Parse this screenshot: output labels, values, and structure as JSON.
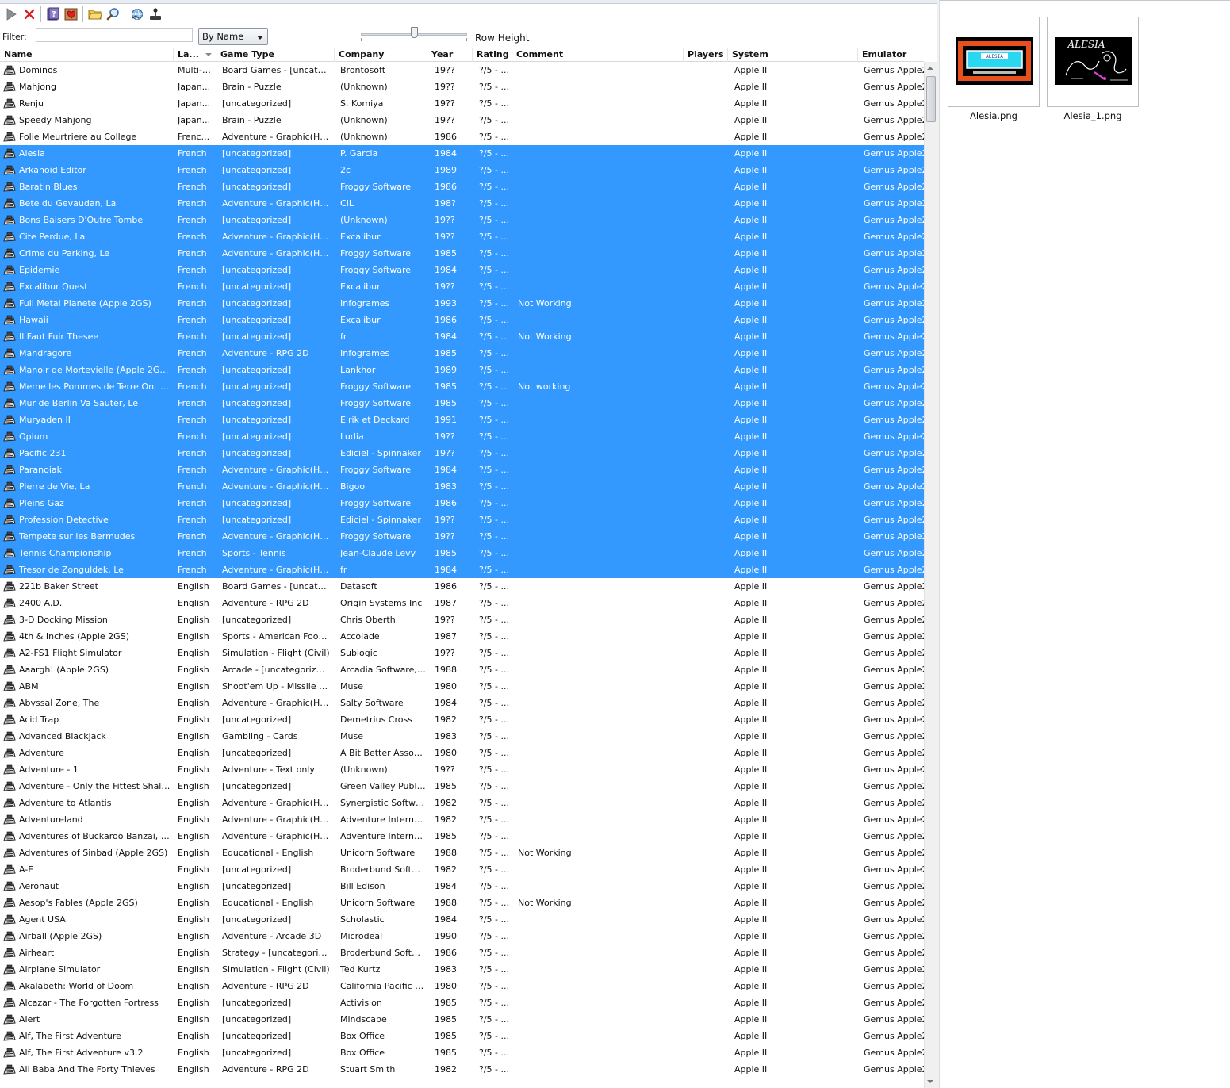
{
  "toolbar": {
    "buttons": [
      {
        "name": "play-button",
        "icon": "play-icon"
      },
      {
        "name": "remove-button",
        "icon": "close-icon"
      },
      {
        "name": "help-button",
        "icon": "help-icon"
      },
      {
        "name": "favorite-button",
        "icon": "heart-icon"
      },
      {
        "name": "open-folder-button",
        "icon": "folder-icon"
      },
      {
        "name": "search-button",
        "icon": "magnifier-icon"
      },
      {
        "name": "network-button",
        "icon": "globe-icon"
      },
      {
        "name": "download-button",
        "icon": "joystick-icon"
      }
    ]
  },
  "filter": {
    "label": "Filter:",
    "value": "",
    "sort_selected": "By Name",
    "row_height_label": "Row Height",
    "row_height_level": 0.5
  },
  "columns": [
    {
      "key": "name",
      "label": "Name"
    },
    {
      "key": "lang",
      "label": "La..."
    },
    {
      "key": "type",
      "label": "Game Type"
    },
    {
      "key": "company",
      "label": "Company"
    },
    {
      "key": "year",
      "label": "Year"
    },
    {
      "key": "rating",
      "label": "Rating"
    },
    {
      "key": "comment",
      "label": "Comment"
    },
    {
      "key": "players",
      "label": "Players"
    },
    {
      "key": "system",
      "label": "System"
    },
    {
      "key": "emulator",
      "label": "Emulator"
    }
  ],
  "rows": [
    [
      "Dominos",
      "Multi-L...",
      "Board Games - [uncatego...",
      "Brontosoft",
      "19??",
      "?/5 - ...",
      "",
      "",
      "Apple II",
      "Gemus Apple2M",
      0
    ],
    [
      "Mahjong",
      "Japan...",
      "Brain - Puzzle",
      "(Unknown)",
      "19??",
      "?/5 - ...",
      "",
      "",
      "Apple II",
      "Gemus Apple2M",
      0
    ],
    [
      "Renju",
      "Japan...",
      "[uncategorized]",
      "S. Komiya",
      "19??",
      "?/5 - ...",
      "",
      "",
      "Apple II",
      "Gemus Apple2M",
      0
    ],
    [
      "Speedy Mahjong",
      "Japan...",
      "Brain - Puzzle",
      "(Unknown)",
      "19??",
      "?/5 - ...",
      "",
      "",
      "Apple II",
      "Gemus Apple2M",
      0
    ],
    [
      "Folie Meurtriere au College",
      "Frenc...",
      "Adventure - Graphic(Hi-R...",
      "(Unknown)",
      "1986",
      "?/5 - ...",
      "",
      "",
      "Apple II",
      "Gemus Apple2M",
      0
    ],
    [
      "Alesia",
      "French",
      "[uncategorized]",
      "P. Garcia",
      "1984",
      "?/5 - ...",
      "",
      "",
      "Apple II",
      "Gemus Apple2M",
      1
    ],
    [
      "Arkanoid Editor",
      "French",
      "[uncategorized]",
      "2c",
      "1989",
      "?/5 - ...",
      "",
      "",
      "Apple II",
      "Gemus Apple2M",
      1
    ],
    [
      "Baratin Blues",
      "French",
      "[uncategorized]",
      "Froggy Software",
      "1986",
      "?/5 - ...",
      "",
      "",
      "Apple II",
      "Gemus Apple2M",
      1
    ],
    [
      "Bete du Gevaudan, La",
      "French",
      "Adventure - Graphic(Hi-R...",
      "CIL",
      "198?",
      "?/5 - ...",
      "",
      "",
      "Apple II",
      "Gemus Apple2M",
      1
    ],
    [
      "Bons Baisers D'Outre Tombe",
      "French",
      "[uncategorized]",
      "(Unknown)",
      "19??",
      "?/5 - ...",
      "",
      "",
      "Apple II",
      "Gemus Apple2M",
      1
    ],
    [
      "Cite Perdue, La",
      "French",
      "Adventure - Graphic(Hi-R...",
      "Excalibur",
      "19??",
      "?/5 - ...",
      "",
      "",
      "Apple II",
      "Gemus Apple2M",
      1
    ],
    [
      "Crime du Parking, Le",
      "French",
      "Adventure - Graphic(Hi-R...",
      "Froggy Software",
      "1985",
      "?/5 - ...",
      "",
      "",
      "Apple II",
      "Gemus Apple2M",
      1
    ],
    [
      "Epidemie",
      "French",
      "[uncategorized]",
      "Froggy Software",
      "1984",
      "?/5 - ...",
      "",
      "",
      "Apple II",
      "Gemus Apple2M",
      1
    ],
    [
      "Excalibur Quest",
      "French",
      "[uncategorized]",
      "Excalibur",
      "19??",
      "?/5 - ...",
      "",
      "",
      "Apple II",
      "Gemus Apple2M",
      1
    ],
    [
      "Full Metal Planete (Apple 2GS)",
      "French",
      "[uncategorized]",
      "Infogrames",
      "1993",
      "?/5 - ...",
      "Not Working",
      "",
      "Apple II",
      "Gemus Apple2M",
      1
    ],
    [
      "Hawaii",
      "French",
      "[uncategorized]",
      "Excalibur",
      "1986",
      "?/5 - ...",
      "",
      "",
      "Apple II",
      "Gemus Apple2M",
      1
    ],
    [
      "Il Faut Fuir Thesee",
      "French",
      "[uncategorized]",
      "fr",
      "1984",
      "?/5 - ...",
      "Not Working",
      "",
      "Apple II",
      "Gemus Apple2M",
      1
    ],
    [
      "Mandragore",
      "French",
      "Adventure - RPG 2D",
      "Infogrames",
      "1985",
      "?/5 - ...",
      "",
      "",
      "Apple II",
      "Gemus Apple2M",
      1
    ],
    [
      "Manoir de Mortevielle (Apple 2GS), Le",
      "French",
      "[uncategorized]",
      "Lankhor",
      "1989",
      "?/5 - ...",
      "",
      "",
      "Apple II",
      "Gemus Apple2M",
      1
    ],
    [
      "Meme les Pommes de Terre Ont des ...",
      "French",
      "[uncategorized]",
      "Froggy Software",
      "1985",
      "?/5 - ...",
      "Not working",
      "",
      "Apple II",
      "Gemus Apple2M",
      1
    ],
    [
      "Mur de Berlin Va Sauter, Le",
      "French",
      "[uncategorized]",
      "Froggy Software",
      "1985",
      "?/5 - ...",
      "",
      "",
      "Apple II",
      "Gemus Apple2M",
      1
    ],
    [
      "Muryaden II",
      "French",
      "[uncategorized]",
      "Elrik et Deckard",
      "1991",
      "?/5 - ...",
      "",
      "",
      "Apple II",
      "Gemus Apple2M",
      1
    ],
    [
      "Opium",
      "French",
      "[uncategorized]",
      "Ludia",
      "19??",
      "?/5 - ...",
      "",
      "",
      "Apple II",
      "Gemus Apple2M",
      1
    ],
    [
      "Pacific 231",
      "French",
      "[uncategorized]",
      "Ediciel - Spinnaker",
      "19??",
      "?/5 - ...",
      "",
      "",
      "Apple II",
      "Gemus Apple2M",
      1
    ],
    [
      "Paranoiak",
      "French",
      "Adventure - Graphic(Hi-R...",
      "Froggy Software",
      "1984",
      "?/5 - ...",
      "",
      "",
      "Apple II",
      "Gemus Apple2M",
      1
    ],
    [
      "Pierre de Vie, La",
      "French",
      "Adventure - Graphic(Hi-R...",
      "Bigoo",
      "1983",
      "?/5 - ...",
      "",
      "",
      "Apple II",
      "Gemus Apple2M",
      1
    ],
    [
      "Pleins Gaz",
      "French",
      "[uncategorized]",
      "Froggy Software",
      "1986",
      "?/5 - ...",
      "",
      "",
      "Apple II",
      "Gemus Apple2M",
      1
    ],
    [
      "Profession Detective",
      "French",
      "[uncategorized]",
      "Ediciel - Spinnaker",
      "19??",
      "?/5 - ...",
      "",
      "",
      "Apple II",
      "Gemus Apple2M",
      1
    ],
    [
      "Tempete sur les Bermudes",
      "French",
      "Adventure - Graphic(Hi-R...",
      "Froggy Software",
      "19??",
      "?/5 - ...",
      "",
      "",
      "Apple II",
      "Gemus Apple2M",
      1
    ],
    [
      "Tennis Championship",
      "French",
      "Sports - Tennis",
      "Jean-Claude Levy",
      "1985",
      "?/5 - ...",
      "",
      "",
      "Apple II",
      "Gemus Apple2M",
      1
    ],
    [
      "Tresor de Zonguldek, Le",
      "French",
      "Adventure - Graphic(Hi-R...",
      "fr",
      "1984",
      "?/5 - ...",
      "",
      "",
      "Apple II",
      "Gemus Apple2M",
      1
    ],
    [
      "221b Baker Street",
      "English",
      "Board Games - [uncatego...",
      "Datasoft",
      "1986",
      "?/5 - ...",
      "",
      "",
      "Apple II",
      "Gemus Apple2M",
      0
    ],
    [
      "2400 A.D.",
      "English",
      "Adventure - RPG 2D",
      "Origin Systems Inc",
      "1987",
      "?/5 - ...",
      "",
      "",
      "Apple II",
      "Gemus Apple2M",
      0
    ],
    [
      "3-D Docking Mission",
      "English",
      "[uncategorized]",
      "Chris Oberth",
      "19??",
      "?/5 - ...",
      "",
      "",
      "Apple II",
      "Gemus Apple2M",
      0
    ],
    [
      "4th & Inches (Apple 2GS)",
      "English",
      "Sports - American Football",
      "Accolade",
      "1987",
      "?/5 - ...",
      "",
      "",
      "Apple II",
      "Gemus Apple2M",
      0
    ],
    [
      "A2-FS1 Flight Simulator",
      "English",
      "Simulation - Flight (Civil)",
      "Sublogic",
      "19??",
      "?/5 - ...",
      "",
      "",
      "Apple II",
      "Gemus Apple2M",
      0
    ],
    [
      "Aaargh! (Apple 2GS)",
      "English",
      "Arcade - [uncategorized]",
      "Arcadia Software, I...",
      "1988",
      "?/5 - ...",
      "",
      "",
      "Apple II",
      "Gemus Apple2M",
      0
    ],
    [
      "ABM",
      "English",
      "Shoot'em Up - Missile Com...",
      "Muse",
      "1980",
      "?/5 - ...",
      "",
      "",
      "Apple II",
      "Gemus Apple2M",
      0
    ],
    [
      "Abyssal Zone, The",
      "English",
      "Adventure - Graphic(Hi-R...",
      "Salty Software",
      "1984",
      "?/5 - ...",
      "",
      "",
      "Apple II",
      "Gemus Apple2M",
      0
    ],
    [
      "Acid Trap",
      "English",
      "[uncategorized]",
      "Demetrius Cross",
      "1982",
      "?/5 - ...",
      "",
      "",
      "Apple II",
      "Gemus Apple2M",
      0
    ],
    [
      "Advanced Blackjack",
      "English",
      "Gambling - Cards",
      "Muse",
      "1983",
      "?/5 - ...",
      "",
      "",
      "Apple II",
      "Gemus Apple2M",
      0
    ],
    [
      "Adventure",
      "English",
      "[uncategorized]",
      "A Bit Better Associa...",
      "1980",
      "?/5 - ...",
      "",
      "",
      "Apple II",
      "Gemus Apple2M",
      0
    ],
    [
      "Adventure - 1",
      "English",
      "Adventure - Text only",
      "(Unknown)",
      "19??",
      "?/5 - ...",
      "",
      "",
      "Apple II",
      "Gemus Apple2M",
      0
    ],
    [
      "Adventure - Only the Fittest Shall Su...",
      "English",
      "[uncategorized]",
      "Green Valley Publis...",
      "1985",
      "?/5 - ...",
      "",
      "",
      "Apple II",
      "Gemus Apple2M",
      0
    ],
    [
      "Adventure to Atlantis",
      "English",
      "Adventure - Graphic(Hi-R...",
      "Synergistic Software",
      "1982",
      "?/5 - ...",
      "",
      "",
      "Apple II",
      "Gemus Apple2M",
      0
    ],
    [
      "Adventureland",
      "English",
      "Adventure - Graphic(Hi-R...",
      "Adventure Internat...",
      "1982",
      "?/5 - ...",
      "",
      "",
      "Apple II",
      "Gemus Apple2M",
      0
    ],
    [
      "Adventures of Buckaroo Banzai, The",
      "English",
      "Adventure - Graphic(Hi-R...",
      "Adventure Internat...",
      "1985",
      "?/5 - ...",
      "",
      "",
      "Apple II",
      "Gemus Apple2M",
      0
    ],
    [
      "Adventures of Sinbad (Apple 2GS)",
      "English",
      "Educational - English",
      "Unicorn Software",
      "1988",
      "?/5 - ...",
      "Not Working",
      "",
      "Apple II",
      "Gemus Apple2M",
      0
    ],
    [
      "A-E",
      "English",
      "[uncategorized]",
      "Broderbund Software",
      "1982",
      "?/5 - ...",
      "",
      "",
      "Apple II",
      "Gemus Apple2M",
      0
    ],
    [
      "Aeronaut",
      "English",
      "[uncategorized]",
      "Bill Edison",
      "1984",
      "?/5 - ...",
      "",
      "",
      "Apple II",
      "Gemus Apple2M",
      0
    ],
    [
      "Aesop's Fables (Apple 2GS)",
      "English",
      "Educational - English",
      "Unicorn Software",
      "1988",
      "?/5 - ...",
      "Not Working",
      "",
      "Apple II",
      "Gemus Apple2M",
      0
    ],
    [
      "Agent USA",
      "English",
      "[uncategorized]",
      "Scholastic",
      "1984",
      "?/5 - ...",
      "",
      "",
      "Apple II",
      "Gemus Apple2M",
      0
    ],
    [
      "Airball (Apple 2GS)",
      "English",
      "Adventure - Arcade 3D",
      "Microdeal",
      "1990",
      "?/5 - ...",
      "",
      "",
      "Apple II",
      "Gemus Apple2M",
      0
    ],
    [
      "Airheart",
      "English",
      "Strategy - [uncategorized]",
      "Broderbund Software",
      "1986",
      "?/5 - ...",
      "",
      "",
      "Apple II",
      "Gemus Apple2M",
      0
    ],
    [
      "Airplane Simulator",
      "English",
      "Simulation - Flight (Civil)",
      "Ted Kurtz",
      "1983",
      "?/5 - ...",
      "",
      "",
      "Apple II",
      "Gemus Apple2M",
      0
    ],
    [
      "Akalabeth: World of Doom",
      "English",
      "Adventure - RPG 2D",
      "California Pacific Co...",
      "1980",
      "?/5 - ...",
      "",
      "",
      "Apple II",
      "Gemus Apple2M",
      0
    ],
    [
      "Alcazar - The Forgotten Fortress",
      "English",
      "[uncategorized]",
      "Activision",
      "1985",
      "?/5 - ...",
      "",
      "",
      "Apple II",
      "Gemus Apple2M",
      0
    ],
    [
      "Alert",
      "English",
      "[uncategorized]",
      "Mindscape",
      "1985",
      "?/5 - ...",
      "",
      "",
      "Apple II",
      "Gemus Apple2M",
      0
    ],
    [
      "Alf, The First Adventure",
      "English",
      "[uncategorized]",
      "Box Office",
      "1985",
      "?/5 - ...",
      "",
      "",
      "Apple II",
      "Gemus Apple2M",
      0
    ],
    [
      "Alf, The First Adventure v3.2",
      "English",
      "[uncategorized]",
      "Box Office",
      "1985",
      "?/5 - ...",
      "",
      "",
      "Apple II",
      "Gemus Apple2M",
      0
    ],
    [
      "Ali Baba And The Forty Thieves",
      "English",
      "Adventure - RPG 2D",
      "Stuart Smith",
      "1982",
      "?/5 - ...",
      "",
      "",
      "Apple II",
      "Gemus Apple2M",
      0
    ]
  ],
  "screenshots": [
    {
      "caption": "Alesia.png",
      "screen_text": "ALESIA"
    },
    {
      "caption": "Alesia_1.png",
      "screen_text": "ALESIA"
    }
  ],
  "colors": {
    "selection": "#3399ff",
    "selection_text": "#ffffff"
  }
}
